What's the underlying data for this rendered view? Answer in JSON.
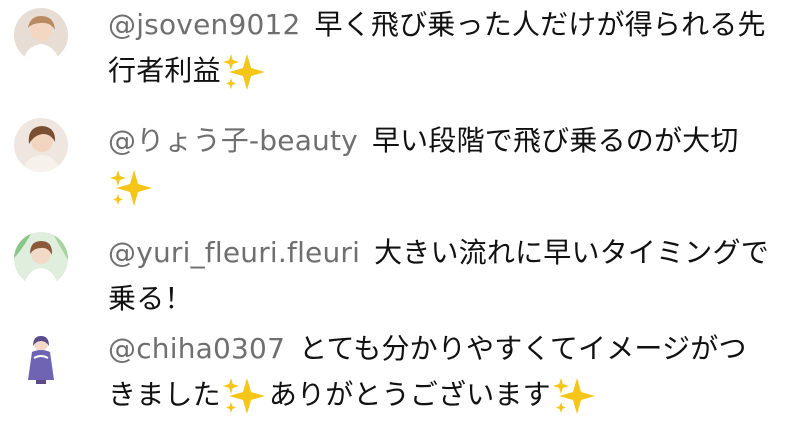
{
  "comments": [
    {
      "author": "@jsoven9012",
      "line1": "早く飛び乗った人だけが得られる先",
      "line2": "行者利益",
      "avatar_icon": "user-avatar-photo",
      "spark_icon": "sparkles-emoji"
    },
    {
      "author": "@りょう子-beauty",
      "line1": "早い段階で飛び乗るのが大切",
      "line2": "",
      "avatar_icon": "user-avatar-photo",
      "spark_icon": "sparkles-emoji"
    },
    {
      "author": "@yuri_fleuri.fleuri",
      "line1": "大きい流れに早いタイミングで",
      "line2": "乗る！",
      "avatar_icon": "user-avatar-photo"
    },
    {
      "author": "@chiha0307",
      "line1": "とても分かりやすくてイメージがつ",
      "line2a": "きました",
      "line2b": "ありがとうございます",
      "avatar_icon": "user-avatar-illustration",
      "spark_icon": "sparkles-emoji"
    }
  ],
  "colors": {
    "author": "#6f6f6f",
    "text": "#111111",
    "sparkle": "#f5c518"
  }
}
